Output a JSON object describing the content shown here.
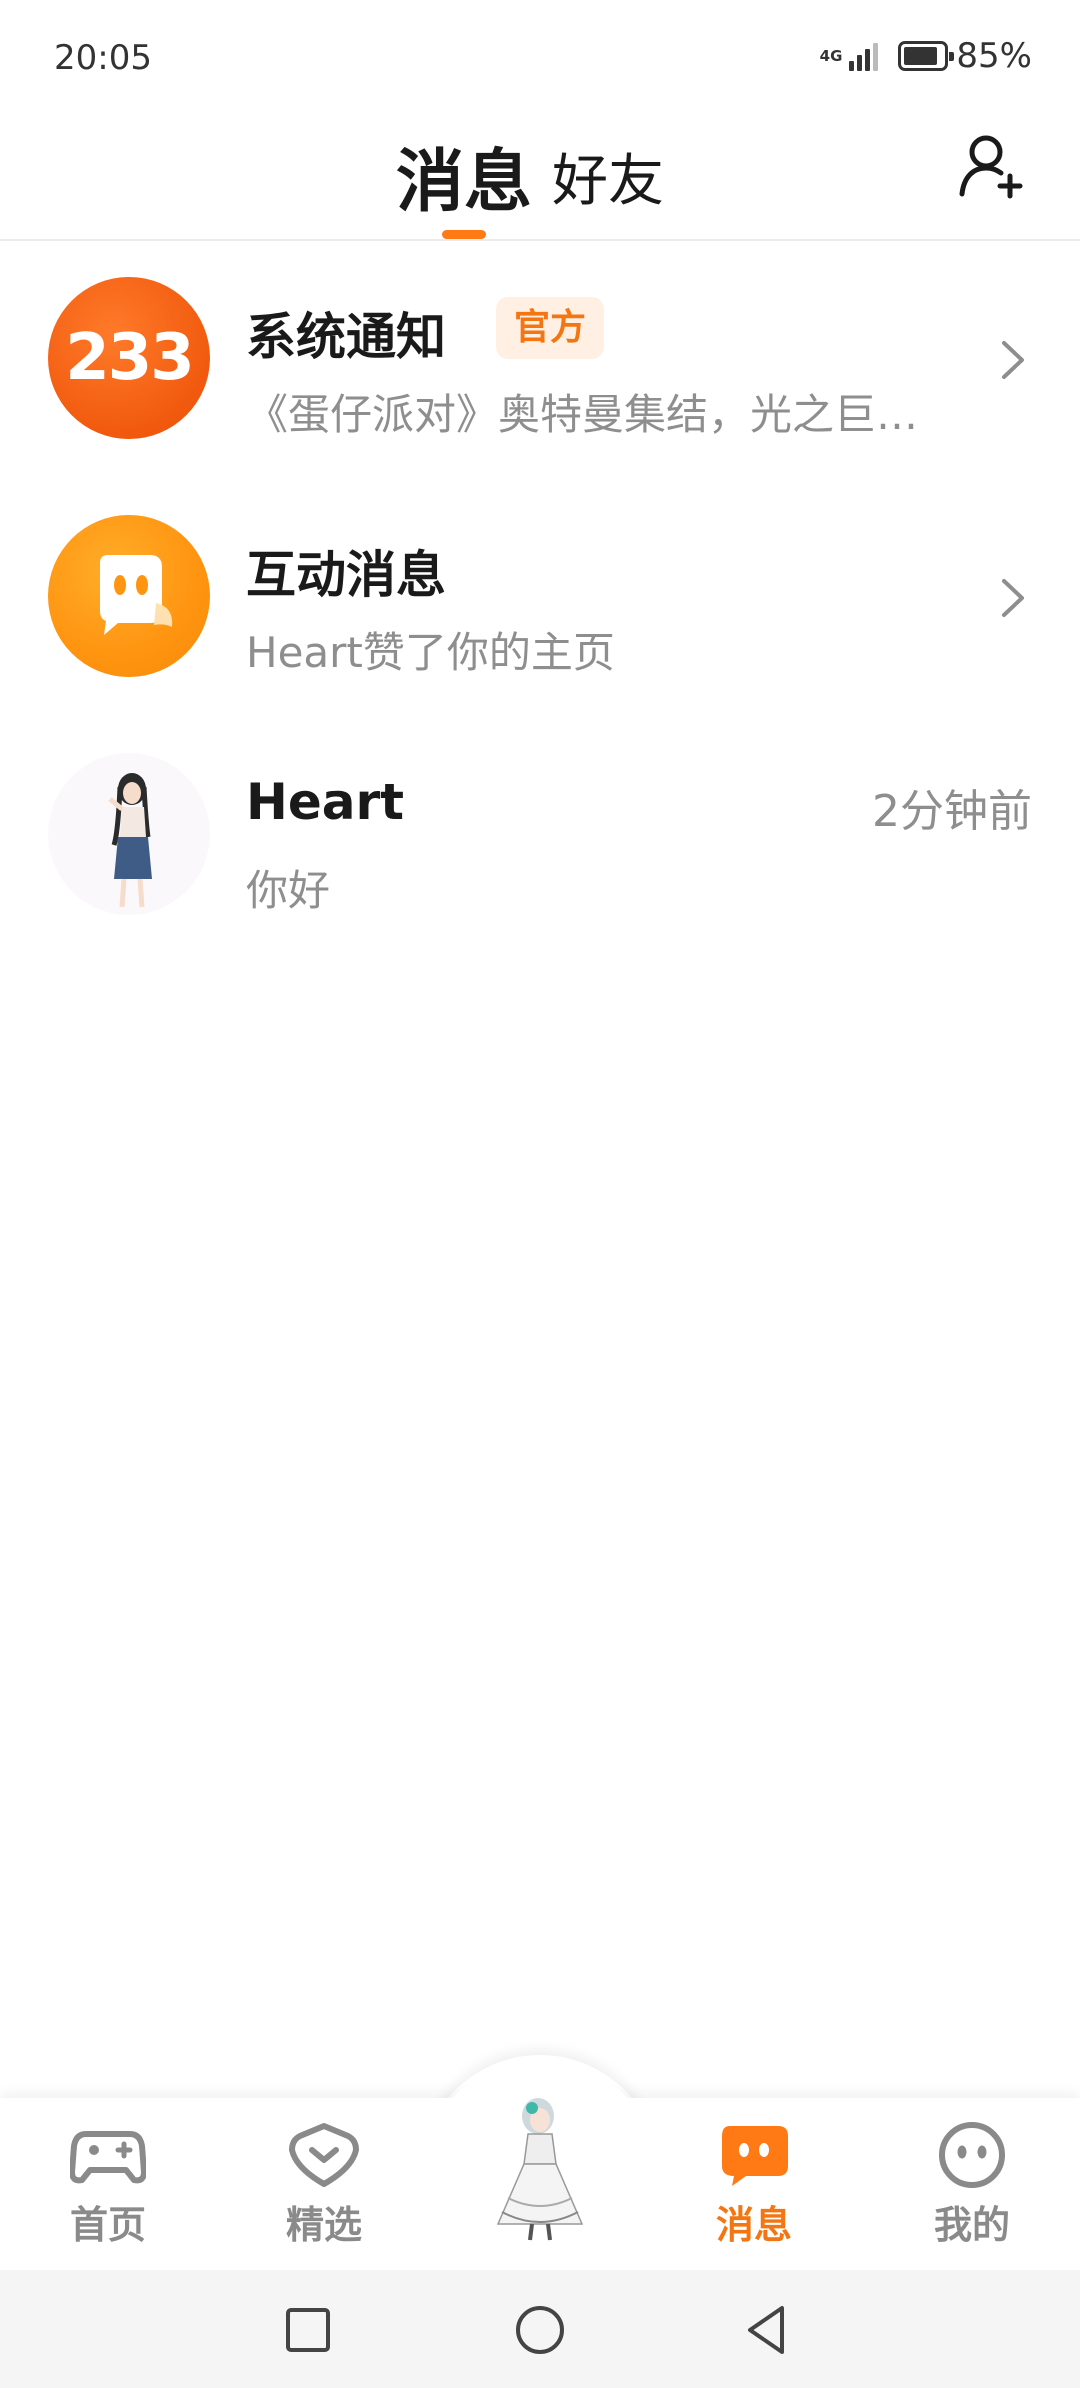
{
  "status_bar": {
    "time": "20:05",
    "network": "4G",
    "battery_percent": "85%",
    "battery_level": 0.85
  },
  "header": {
    "tabs": [
      {
        "label": "消息",
        "active": true
      },
      {
        "label": "好友",
        "active": false
      }
    ],
    "add_friend_icon": "add-person-icon",
    "accent_color": "#ff7a14"
  },
  "messages": [
    {
      "avatar_text": "233",
      "title": "系统通知",
      "badge": "官方",
      "preview": "《蛋仔派对》奥特曼集结，光之巨…",
      "trailing": "chevron-right-icon"
    },
    {
      "avatar_icon": "chat-bubble-face-icon",
      "title": "互动消息",
      "preview": "Heart赞了你的主页",
      "trailing": "chevron-right-icon"
    },
    {
      "avatar_icon": "user-avatar",
      "title": "Heart",
      "preview": "你好",
      "time": "2分钟前"
    }
  ],
  "bottom_nav": {
    "items": [
      {
        "label": "首页",
        "icon": "gamepad-icon",
        "active": false
      },
      {
        "label": "精选",
        "icon": "heart-badge-icon",
        "active": false
      },
      {
        "label": "消息",
        "icon": "chat-icon",
        "active": true
      },
      {
        "label": "我的",
        "icon": "smiley-icon",
        "active": false
      }
    ],
    "center_icon": "character-avatar",
    "active_color": "#f47612",
    "inactive_color": "#8a8a8a"
  },
  "system_nav": {
    "buttons": [
      "recent-apps-icon",
      "home-icon",
      "back-icon"
    ]
  }
}
